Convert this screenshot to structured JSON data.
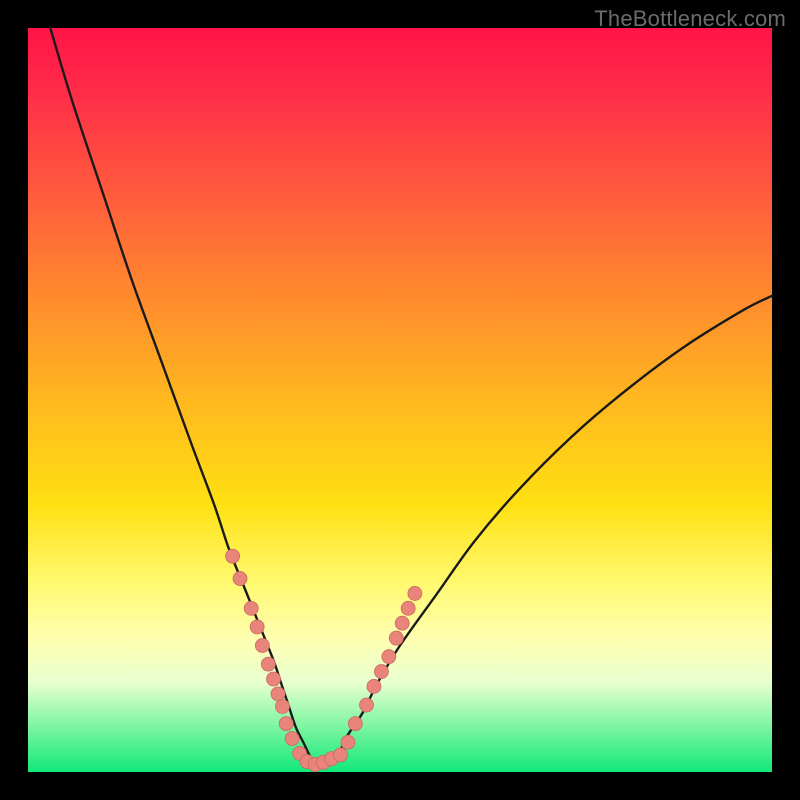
{
  "watermark": "TheBottleneck.com",
  "colors": {
    "frame": "#000000",
    "curve_stroke": "#1a1a1a",
    "marker_fill": "#e9847a",
    "marker_stroke": "#c96a62"
  },
  "chart_data": {
    "type": "line",
    "title": "",
    "xlabel": "",
    "ylabel": "",
    "xlim": [
      0,
      100
    ],
    "ylim": [
      0,
      100
    ],
    "grid": false,
    "legend": false,
    "series": [
      {
        "name": "bottleneck-curve",
        "description": "V-shaped bottleneck curve; y ≈ mismatch percentage, minimum near x≈38",
        "x": [
          3,
          6,
          10,
          14,
          18,
          22,
          25,
          27,
          29,
          31,
          33,
          34,
          35,
          36,
          37,
          38,
          39,
          40,
          41,
          42,
          43,
          45,
          47,
          50,
          55,
          60,
          66,
          73,
          80,
          88,
          96,
          100
        ],
        "y": [
          100,
          90,
          78,
          66,
          55,
          44,
          36,
          30,
          25,
          20,
          15,
          12,
          9,
          6,
          4,
          2,
          1,
          1,
          2,
          3,
          5,
          8,
          12,
          17,
          24,
          31,
          38,
          45,
          51,
          57,
          62,
          64
        ]
      }
    ],
    "markers": {
      "description": "salmon circular markers clustered near the curve minimum (threshold region)",
      "points": [
        {
          "x": 27.5,
          "y": 29
        },
        {
          "x": 28.5,
          "y": 26
        },
        {
          "x": 30.0,
          "y": 22
        },
        {
          "x": 30.8,
          "y": 19.5
        },
        {
          "x": 31.5,
          "y": 17
        },
        {
          "x": 32.3,
          "y": 14.5
        },
        {
          "x": 33.0,
          "y": 12.5
        },
        {
          "x": 33.6,
          "y": 10.5
        },
        {
          "x": 34.2,
          "y": 8.8
        },
        {
          "x": 34.7,
          "y": 6.5
        },
        {
          "x": 35.5,
          "y": 4.5
        },
        {
          "x": 36.5,
          "y": 2.5
        },
        {
          "x": 37.5,
          "y": 1.4
        },
        {
          "x": 38.6,
          "y": 1.0
        },
        {
          "x": 39.7,
          "y": 1.3
        },
        {
          "x": 40.8,
          "y": 1.8
        },
        {
          "x": 42.0,
          "y": 2.3
        },
        {
          "x": 43.0,
          "y": 4.0
        },
        {
          "x": 44.0,
          "y": 6.5
        },
        {
          "x": 45.5,
          "y": 9.0
        },
        {
          "x": 46.5,
          "y": 11.5
        },
        {
          "x": 47.5,
          "y": 13.5
        },
        {
          "x": 48.5,
          "y": 15.5
        },
        {
          "x": 49.5,
          "y": 18.0
        },
        {
          "x": 50.3,
          "y": 20.0
        },
        {
          "x": 51.1,
          "y": 22.0
        },
        {
          "x": 52.0,
          "y": 24.0
        }
      ],
      "radius_px": 7
    }
  }
}
